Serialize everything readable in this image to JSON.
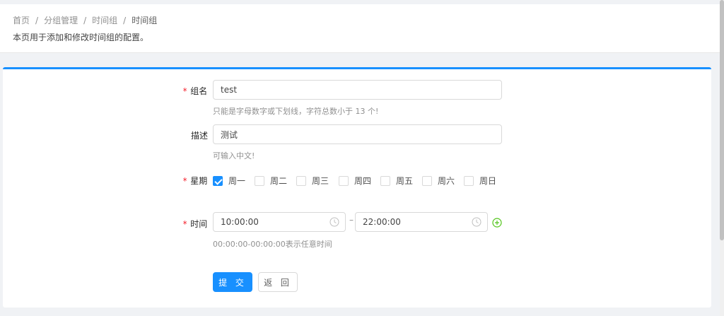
{
  "breadcrumb": {
    "items": [
      "首页",
      "分组管理",
      "时间组",
      "时间组"
    ],
    "separator": "/"
  },
  "page_description": "本页用于添加和修改时间组的配置。",
  "form": {
    "name": {
      "label": "组名",
      "required": true,
      "value": "test",
      "hint": "只能是字母数字或下划线，字符总数小于 13 个!"
    },
    "description": {
      "label": "描述",
      "required": false,
      "value": "测试",
      "hint": "可输入中文!"
    },
    "weekdays": {
      "label": "星期",
      "required": true,
      "options": [
        {
          "label": "周一",
          "checked": true
        },
        {
          "label": "周二",
          "checked": false
        },
        {
          "label": "周三",
          "checked": false
        },
        {
          "label": "周四",
          "checked": false
        },
        {
          "label": "周五",
          "checked": false
        },
        {
          "label": "周六",
          "checked": false
        },
        {
          "label": "周日",
          "checked": false
        }
      ]
    },
    "time": {
      "label": "时间",
      "required": true,
      "start": "10:00:00",
      "end": "22:00:00",
      "separator": "–",
      "hint": "00:00:00-00:00:00表示任意时间"
    }
  },
  "buttons": {
    "submit_label": "提 交",
    "back_label": "返 回"
  },
  "colors": {
    "primary": "#1890ff",
    "required_mark": "#f5222d",
    "add_icon": "#52c41a"
  },
  "icons": {
    "clock": "clock-icon",
    "add": "plus-circle-icon",
    "check": "check-icon"
  }
}
